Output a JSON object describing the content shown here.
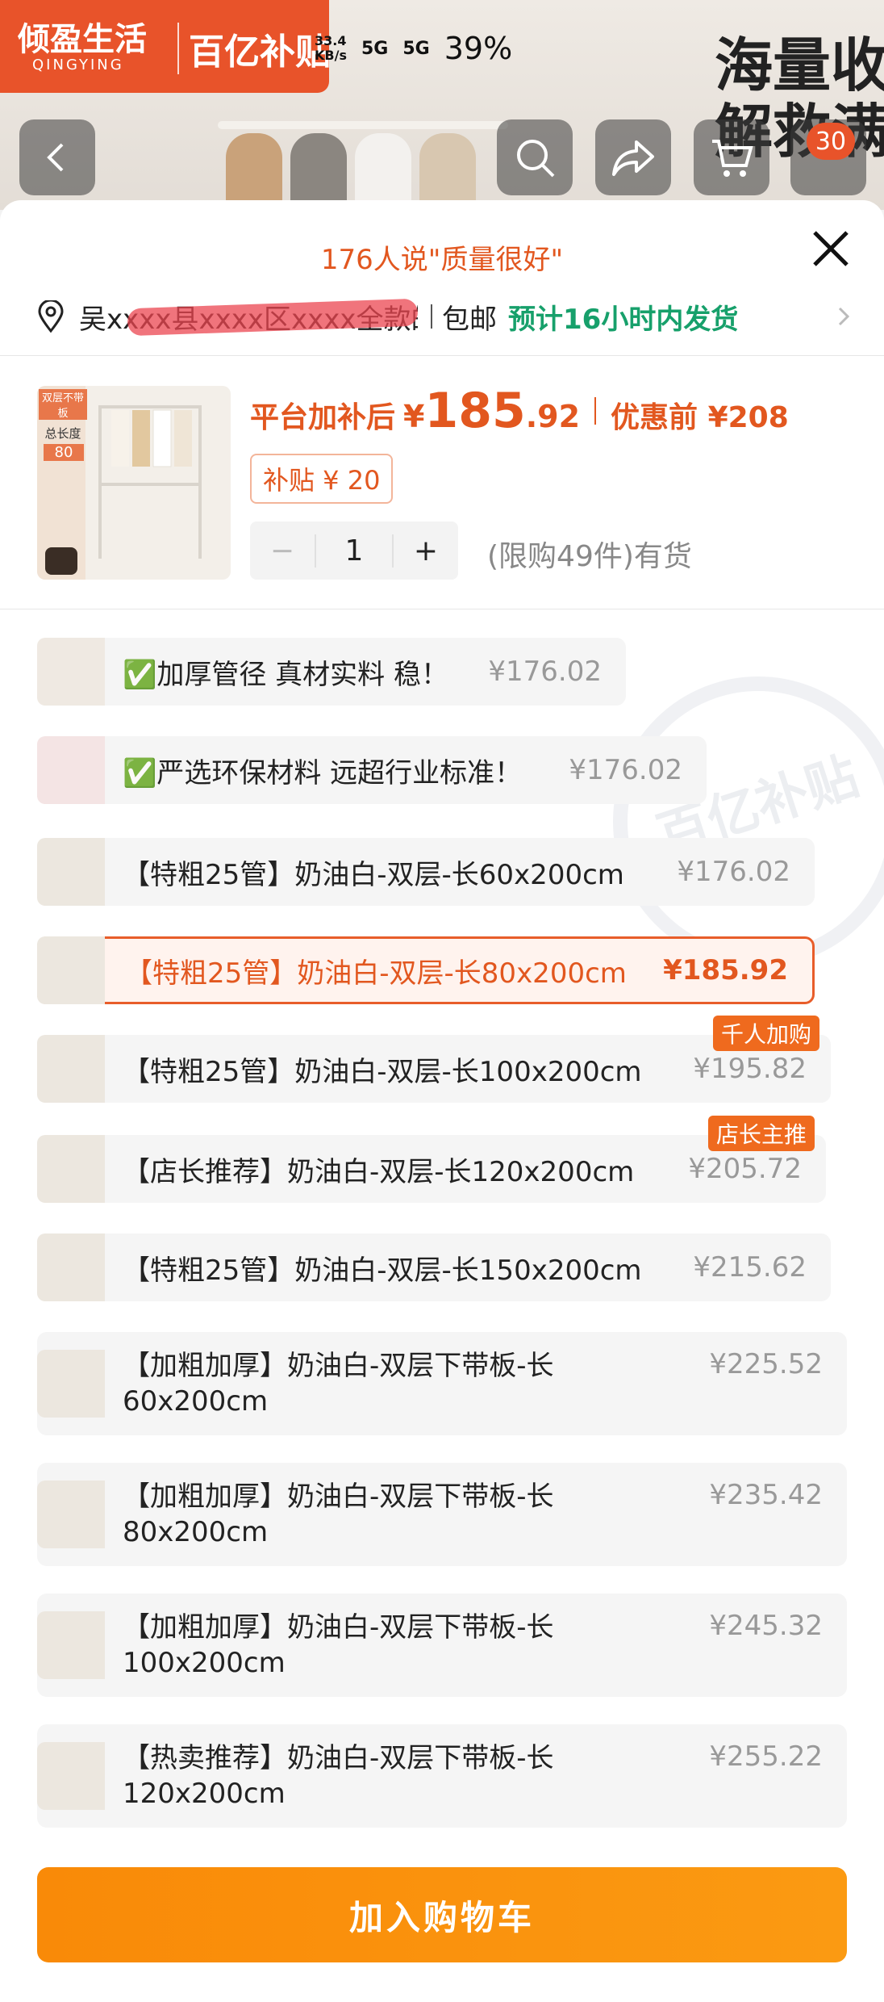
{
  "background": {
    "brand_name": "倾盈生活",
    "brand_sub": "QINGYING",
    "brand_tag": "百亿补贴",
    "promo_text": "海量收\n解救满",
    "cart_count": "30"
  },
  "status_bar": {
    "speed": "33.4\nKB/s",
    "net1": "5G",
    "net2": "5G",
    "battery": "39%"
  },
  "sheet": {
    "rating_text": "176人说\"质量很好\"",
    "address": "吴xxxx县xxxx区xxxx全款的",
    "free_shipping": "包邮",
    "ship_time": "预计16小时内发货"
  },
  "product": {
    "thumb_caption_top": "双层不带板",
    "thumb_caption_mid": "总长度",
    "thumb_caption_len": "80",
    "price_label": "平台加补后",
    "price_symbol": "¥",
    "price_int": "185",
    "price_dec": ".92",
    "orig_label": "优惠前 ¥208",
    "subsidy": "补贴 ¥ 20",
    "quantity": "1",
    "minus": "−",
    "plus": "+",
    "stock": "(限购49件)有货"
  },
  "options": [
    {
      "label": "✅加厚管径 真材实料 稳！",
      "price": "¥176.02"
    },
    {
      "label": "✅严选环保材料 远超行业标准！",
      "price": "¥176.02"
    },
    {
      "label": "【特粗25管】奶油白-双层-长60x200cm",
      "price": "¥176.02"
    },
    {
      "label": "【特粗25管】奶油白-双层-长80x200cm",
      "price": "¥185.92"
    },
    {
      "label": "【特粗25管】奶油白-双层-长100x200cm",
      "price": "¥195.82",
      "tag": "千人加购"
    },
    {
      "label": "【店长推荐】奶油白-双层-长120x200cm",
      "price": "¥205.72",
      "tag": "店长主推"
    },
    {
      "label": "【特粗25管】奶油白-双层-长150x200cm",
      "price": "¥215.62"
    },
    {
      "label": "【加粗加厚】奶油白-双层下带板-长60x200cm",
      "price": "¥225.52"
    },
    {
      "label": "【加粗加厚】奶油白-双层下带板-长80x200cm",
      "price": "¥235.42"
    },
    {
      "label": "【加粗加厚】奶油白-双层下带板-长100x200cm",
      "price": "¥245.32"
    },
    {
      "label": "【热卖推荐】奶油白-双层下带板-长120x200cm",
      "price": "¥255.22"
    }
  ],
  "watermark": "百亿补贴",
  "add_to_cart": "加入购物车",
  "colors": {
    "accent": "#e2571f",
    "ship_green": "#17a06b",
    "cart_orange": "#fb9012",
    "brand_red": "#e8532a"
  },
  "icons": [
    "back-icon",
    "search-icon",
    "share-icon",
    "cart-icon",
    "close-icon",
    "location-icon",
    "chevron-right-icon"
  ]
}
